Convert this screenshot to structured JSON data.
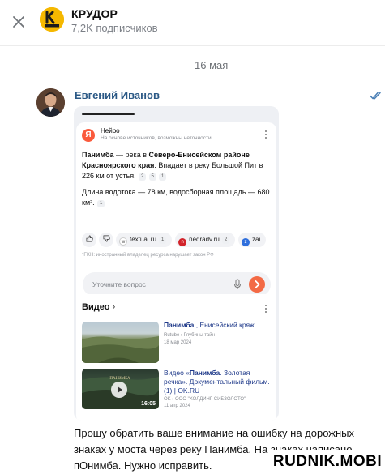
{
  "header": {
    "channel_name": "КРУДОР",
    "subscribers": "7,2K подписчиков",
    "avatar_text": "КРУДОР"
  },
  "date_separator": "16 мая",
  "message": {
    "author": "Евгений Иванов",
    "text": "Прошу обратить ваше внимание на ошибку на дорожных знаках у моста через реку Панимба. На знаках написано пОнимба. Нужно исправить."
  },
  "screenshot": {
    "neiro": {
      "logo": "Я",
      "title": "Нейро",
      "subtitle": "На основе источников, возможны неточности",
      "p1_part1": "Панимба",
      "p1_part2": " — река в ",
      "p1_part3": "Северо-Енисейском районе Красноярского края",
      "p1_part4": ". Впадает в реку Большой Пит в 226 км от устья.",
      "p1_refs": [
        "2",
        "5",
        "1"
      ],
      "p2_text": "Длина водотока — 78 км, водосборная площадь — 680 км².",
      "p2_ref": "1",
      "sources": [
        {
          "icon": "w",
          "name": "textual.ru",
          "count": "1",
          "color": "#ffffff"
        },
        {
          "icon": "n",
          "name": "nedradv.ru",
          "count": "2",
          "color": "#d2232a"
        },
        {
          "icon": "z",
          "name": "zai",
          "count": "",
          "color": "#2f6fdc"
        }
      ],
      "disclaimer": "*FKH: иностранный владелец ресурса нарушает закон РФ",
      "ask_placeholder": "Уточните вопрос"
    },
    "video": {
      "heading": "Видео",
      "chevron": "›",
      "items": [
        {
          "title_bold": "Панимба",
          "title_rest": " , Енисейский кряж",
          "source": "Rutube › Глубины тайн",
          "date": "18 мар 2024",
          "duration": ""
        },
        {
          "title_pre": "Видео «",
          "title_bold": "Панимба",
          "title_rest": ". Золотая речка». Документальный фильм. (1) | OK.RU",
          "source": "OK › ООО \"ХОЛДИНГ СИБЗОЛОТО\"",
          "date": "11 апр 2024",
          "duration": "16:05"
        }
      ]
    }
  },
  "watermark": "RUDNIK.MOBI",
  "colors": {
    "author": "#2a5885",
    "neiro": "#fa5a3c",
    "send": "#f36a45",
    "video_title": "#1f3a8a",
    "read_check": "#4a7fb5"
  }
}
